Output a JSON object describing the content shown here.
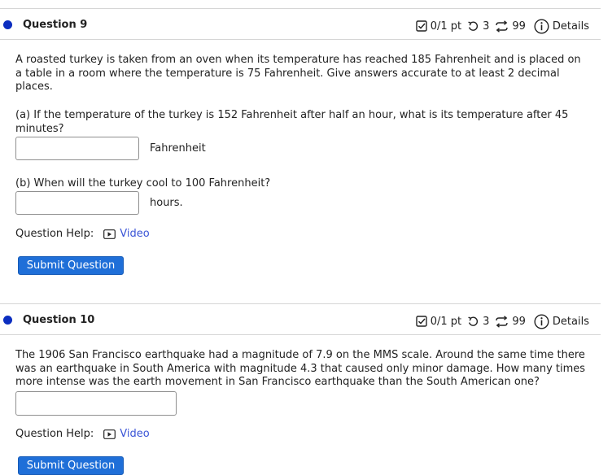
{
  "q9": {
    "title": "Question 9",
    "score": "0/1 pt",
    "retries": "3",
    "attempts": "99",
    "details": "Details",
    "intro": "A roasted turkey is taken from an oven when its temperature has reached 185 Fahrenheit and is placed on a table in a room where the temperature is 75 Fahrenheit. Give answers accurate to at least 2 decimal places.",
    "part_a": "(a) If the temperature of the turkey is 152 Fahrenheit after half an hour, what is its temperature after 45 minutes?",
    "part_a_value": "",
    "part_a_unit": "Fahrenheit",
    "part_b": "(b) When will the turkey cool to 100 Fahrenheit?",
    "part_b_value": "",
    "part_b_unit": "hours.",
    "help_label": "Question Help:",
    "video_label": "Video",
    "submit_label": "Submit Question"
  },
  "q10": {
    "title": "Question 10",
    "score": "0/1 pt",
    "retries": "3",
    "attempts": "99",
    "details": "Details",
    "body": "The 1906 San Francisco earthquake had a magnitude of 7.9 on the MMS scale. Around the same time there was an earthquake in South America with magnitude 4.3 that caused only minor damage. How many times more intense was the earth movement in San Francisco earthquake than the South American one?",
    "answer_value": "",
    "help_label": "Question Help:",
    "video_label": "Video",
    "submit_label": "Submit Question"
  },
  "colors": {
    "dot": "#0c2ec0",
    "button": "#1f6fd8",
    "link": "#3a54d6"
  }
}
